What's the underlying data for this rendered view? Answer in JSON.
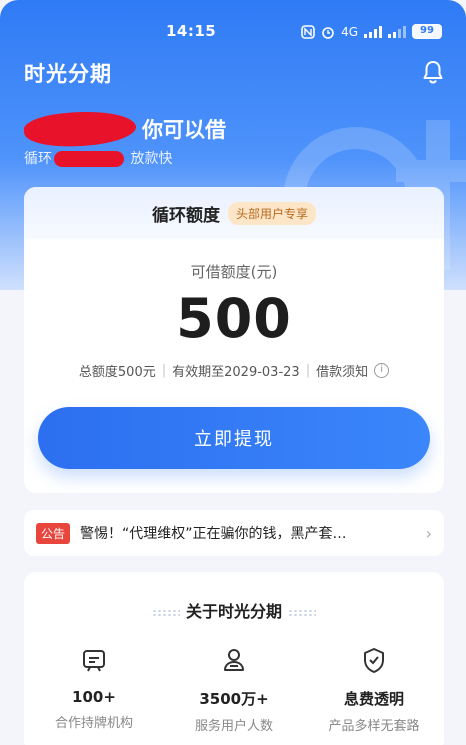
{
  "status_bar": {
    "time": "14:15",
    "battery": "99",
    "signal_text": "4G"
  },
  "header": {
    "app_title": "时光分期"
  },
  "hero": {
    "greeting_suffix": "你可以借",
    "subline_start": "循环",
    "subline_end": "放款快"
  },
  "credit_card": {
    "title": "循环额度",
    "badge": "头部用户专享",
    "limit_label": "可借额度(元)",
    "amount": "500",
    "total_limit": "总额度500元",
    "validity": "有效期至2029-03-23",
    "loan_notice": "借款须知",
    "withdraw_button": "立即提现"
  },
  "notice": {
    "tag": "公告",
    "text": "警惕！“代理维权”正在骗你的钱，黑产套…"
  },
  "about": {
    "title": "关于时光分期",
    "features": [
      {
        "value": "100+",
        "label": "合作持牌机构",
        "icon": "institution-icon"
      },
      {
        "value": "3500万+",
        "label": "服务用户人数",
        "icon": "users-icon"
      },
      {
        "value": "息费透明",
        "label": "产品多样无套路",
        "icon": "shield-check-icon"
      }
    ]
  },
  "colors": {
    "primary": "#2f7bf5",
    "danger": "#e8453c",
    "badge_text": "#b86a1e"
  }
}
